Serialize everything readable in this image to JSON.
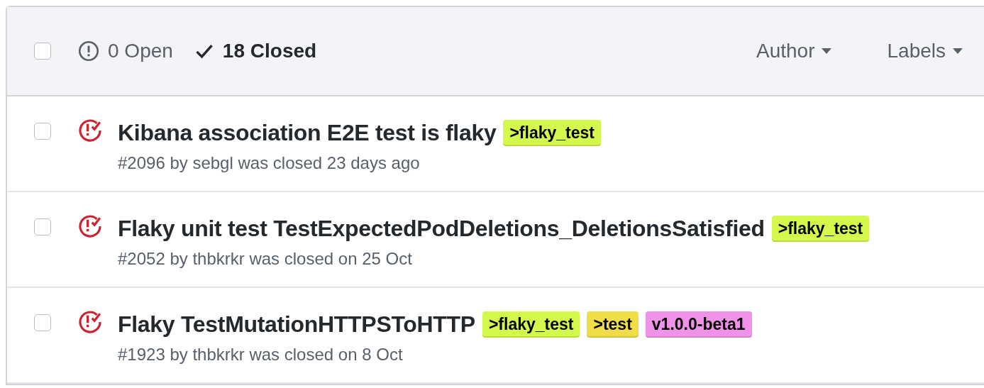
{
  "header": {
    "select_all_checked": false,
    "states": [
      {
        "kind": "open",
        "label": "0 Open",
        "selected": false
      },
      {
        "kind": "closed",
        "label": "18 Closed",
        "selected": true
      }
    ],
    "filters": [
      "Author",
      "Labels"
    ]
  },
  "issues": [
    {
      "checked": false,
      "title": "Kibana association E2E test is flaky",
      "meta": "#2096 by sebgl was closed 23 days ago",
      "labels": [
        {
          "text": ">flaky_test",
          "color": "#d4f94c"
        }
      ]
    },
    {
      "checked": false,
      "title": "Flaky unit test TestExpectedPodDeletions_DeletionsSatisfied",
      "meta": "#2052 by thbkrkr was closed on 25 Oct",
      "labels": [
        {
          "text": ">flaky_test",
          "color": "#d4f94c"
        }
      ]
    },
    {
      "checked": false,
      "title": "Flaky TestMutationHTTPSToHTTP",
      "meta": "#1923 by thbkrkr was closed on 8 Oct",
      "labels": [
        {
          "text": ">flaky_test",
          "color": "#d4f94c"
        },
        {
          "text": ">test",
          "color": "#f1dd48"
        },
        {
          "text": "v1.0.0-beta1",
          "color": "#f192e9"
        }
      ]
    }
  ]
}
